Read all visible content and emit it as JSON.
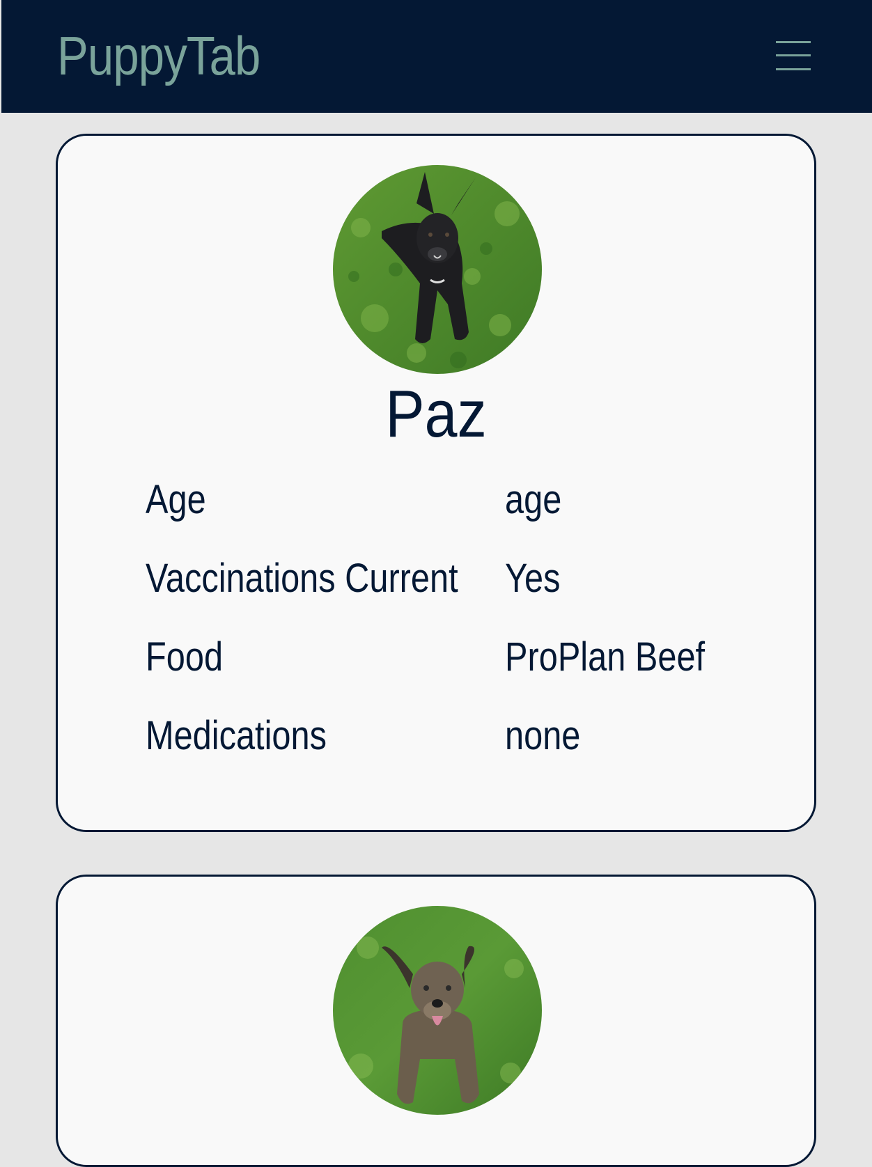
{
  "header": {
    "brand": "PuppyTab",
    "menu_icon": "hamburger-menu-icon"
  },
  "colors": {
    "navbar": "#041834",
    "brand": "#7aa39a",
    "page_background": "#e6e6e6",
    "card_background": "#f9f9f9",
    "text": "#041834"
  },
  "dogs": [
    {
      "photo": "black dog lying on grass",
      "name": "Paz",
      "details": [
        {
          "label": "Age",
          "value": "age"
        },
        {
          "label": "Vaccinations Current",
          "value": "Yes"
        },
        {
          "label": "Food",
          "value": "ProPlan Beef"
        },
        {
          "label": "Medications",
          "value": "none"
        }
      ]
    },
    {
      "photo": "brindle dog sitting on grass with tongue out"
    }
  ]
}
